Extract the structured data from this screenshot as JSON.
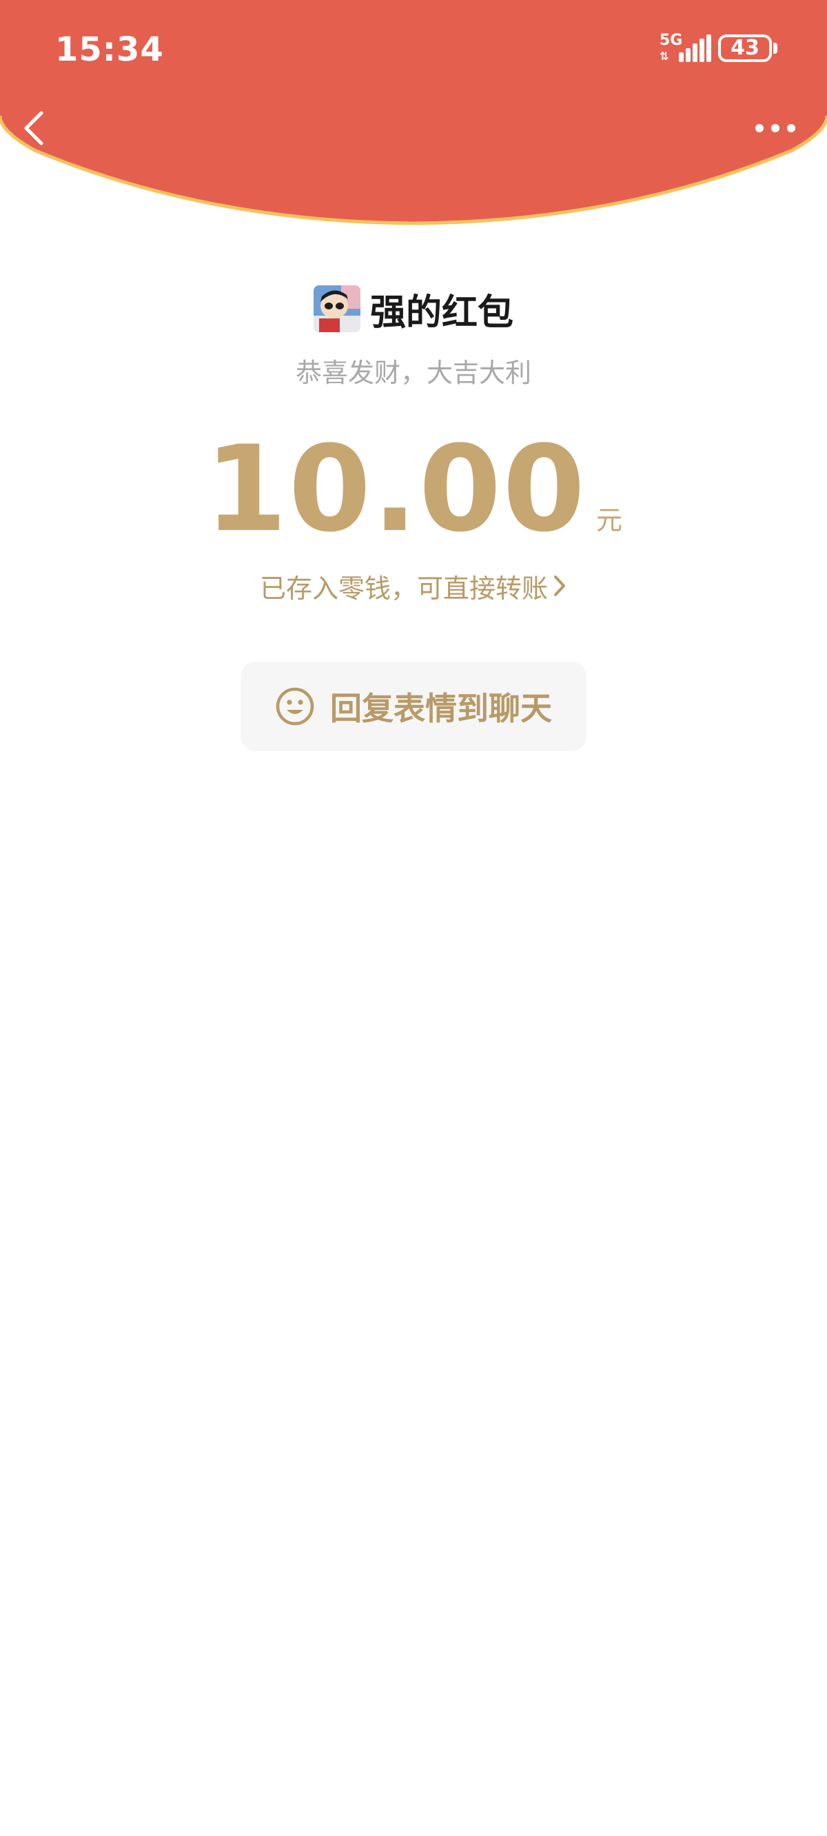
{
  "status_bar": {
    "time": "15:34",
    "network": "5G",
    "data_arrows": "⇅",
    "battery": "43"
  },
  "nav": {
    "back_icon": "chevron-left-icon",
    "more_icon": "more-horizontal-icon"
  },
  "colors": {
    "header_red": "#e55f4e",
    "header_border": "#f2c35f",
    "gold": "#c6a671",
    "gold_dark": "#b89a67",
    "button_bg": "#f6f6f6"
  },
  "packet": {
    "sender_title": "强的红包",
    "blessing": "恭喜发财，大吉大利",
    "amount": "10.00",
    "currency": "元",
    "wallet_note": "已存入零钱，可直接转账"
  },
  "reply": {
    "icon": "smile-icon",
    "label": "回复表情到聊天"
  }
}
